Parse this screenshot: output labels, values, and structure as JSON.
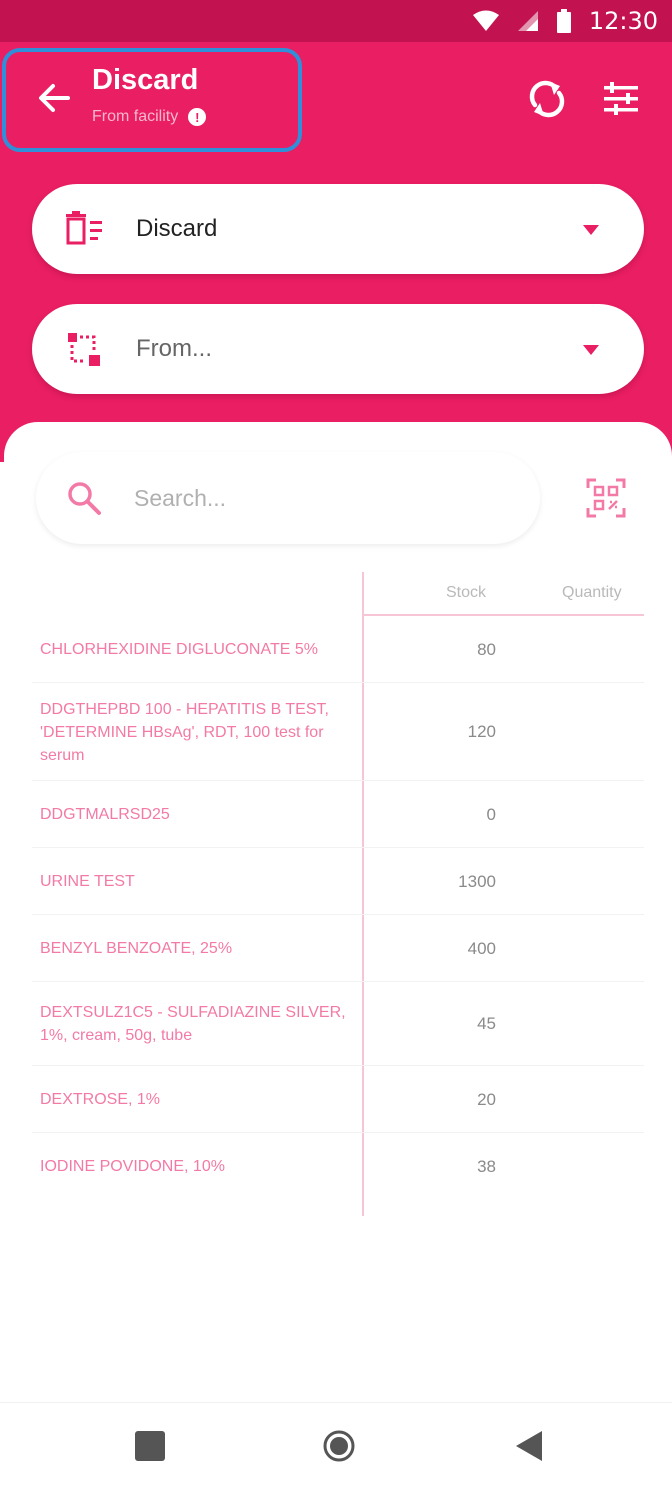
{
  "status_bar": {
    "time": "12:30"
  },
  "header": {
    "title": "Discard",
    "subtitle": "From facility",
    "info_badge": "!"
  },
  "reason_dropdown": {
    "selected": "Discard"
  },
  "from_dropdown": {
    "placeholder": "From..."
  },
  "search": {
    "placeholder": "Search..."
  },
  "table": {
    "headers": {
      "stock": "Stock",
      "quantity": "Quantity"
    },
    "rows": [
      {
        "name": "CHLORHEXIDINE DIGLUCONATE 5%",
        "stock": "80",
        "quantity": ""
      },
      {
        "name": "DDGTHEPBD 100 - HEPATITIS B TEST, 'DETERMINE HBsAg', RDT, 100 test for serum",
        "stock": "120",
        "quantity": ""
      },
      {
        "name": "DDGTMALRSD25",
        "stock": "0",
        "quantity": ""
      },
      {
        "name": "URINE TEST",
        "stock": "1300",
        "quantity": ""
      },
      {
        "name": "BENZYL BENZOATE, 25%",
        "stock": "400",
        "quantity": ""
      },
      {
        "name": "DEXTSULZ1C5 - SULFADIAZINE SILVER, 1%, cream, 50g, tube",
        "stock": "45",
        "quantity": ""
      },
      {
        "name": "DEXTROSE, 1%",
        "stock": "20",
        "quantity": ""
      },
      {
        "name": "IODINE POVIDONE, 10%",
        "stock": "38",
        "quantity": ""
      }
    ]
  },
  "icons": {
    "back": "arrow-left-icon",
    "sync": "sync-icon",
    "filter": "filter-sliders-icon",
    "reason": "trash-list-icon",
    "from": "facility-transfer-icon",
    "search": "search-icon",
    "qr": "qr-scan-icon"
  },
  "colors": {
    "primary": "#ea1e63",
    "status_bar": "#c2124f",
    "highlight_border": "#2f8fd8",
    "row_text": "#f37aa6"
  }
}
